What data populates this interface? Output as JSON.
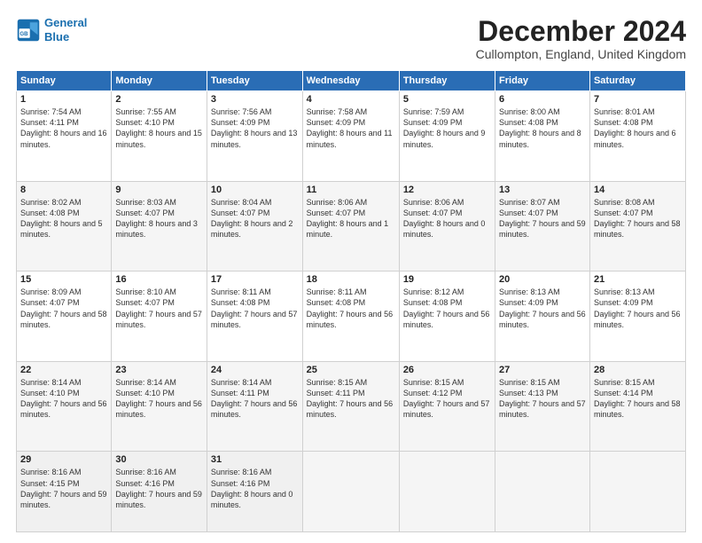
{
  "logo": {
    "line1": "General",
    "line2": "Blue"
  },
  "header": {
    "month": "December 2024",
    "location": "Cullompton, England, United Kingdom"
  },
  "weekdays": [
    "Sunday",
    "Monday",
    "Tuesday",
    "Wednesday",
    "Thursday",
    "Friday",
    "Saturday"
  ],
  "weeks": [
    [
      {
        "day": "1",
        "sunrise": "7:54 AM",
        "sunset": "4:11 PM",
        "daylight": "8 hours and 16 minutes."
      },
      {
        "day": "2",
        "sunrise": "7:55 AM",
        "sunset": "4:10 PM",
        "daylight": "8 hours and 15 minutes."
      },
      {
        "day": "3",
        "sunrise": "7:56 AM",
        "sunset": "4:09 PM",
        "daylight": "8 hours and 13 minutes."
      },
      {
        "day": "4",
        "sunrise": "7:58 AM",
        "sunset": "4:09 PM",
        "daylight": "8 hours and 11 minutes."
      },
      {
        "day": "5",
        "sunrise": "7:59 AM",
        "sunset": "4:09 PM",
        "daylight": "8 hours and 9 minutes."
      },
      {
        "day": "6",
        "sunrise": "8:00 AM",
        "sunset": "4:08 PM",
        "daylight": "8 hours and 8 minutes."
      },
      {
        "day": "7",
        "sunrise": "8:01 AM",
        "sunset": "4:08 PM",
        "daylight": "8 hours and 6 minutes."
      }
    ],
    [
      {
        "day": "8",
        "sunrise": "8:02 AM",
        "sunset": "4:08 PM",
        "daylight": "8 hours and 5 minutes."
      },
      {
        "day": "9",
        "sunrise": "8:03 AM",
        "sunset": "4:07 PM",
        "daylight": "8 hours and 3 minutes."
      },
      {
        "day": "10",
        "sunrise": "8:04 AM",
        "sunset": "4:07 PM",
        "daylight": "8 hours and 2 minutes."
      },
      {
        "day": "11",
        "sunrise": "8:06 AM",
        "sunset": "4:07 PM",
        "daylight": "8 hours and 1 minute."
      },
      {
        "day": "12",
        "sunrise": "8:06 AM",
        "sunset": "4:07 PM",
        "daylight": "8 hours and 0 minutes."
      },
      {
        "day": "13",
        "sunrise": "8:07 AM",
        "sunset": "4:07 PM",
        "daylight": "7 hours and 59 minutes."
      },
      {
        "day": "14",
        "sunrise": "8:08 AM",
        "sunset": "4:07 PM",
        "daylight": "7 hours and 58 minutes."
      }
    ],
    [
      {
        "day": "15",
        "sunrise": "8:09 AM",
        "sunset": "4:07 PM",
        "daylight": "7 hours and 58 minutes."
      },
      {
        "day": "16",
        "sunrise": "8:10 AM",
        "sunset": "4:07 PM",
        "daylight": "7 hours and 57 minutes."
      },
      {
        "day": "17",
        "sunrise": "8:11 AM",
        "sunset": "4:08 PM",
        "daylight": "7 hours and 57 minutes."
      },
      {
        "day": "18",
        "sunrise": "8:11 AM",
        "sunset": "4:08 PM",
        "daylight": "7 hours and 56 minutes."
      },
      {
        "day": "19",
        "sunrise": "8:12 AM",
        "sunset": "4:08 PM",
        "daylight": "7 hours and 56 minutes."
      },
      {
        "day": "20",
        "sunrise": "8:13 AM",
        "sunset": "4:09 PM",
        "daylight": "7 hours and 56 minutes."
      },
      {
        "day": "21",
        "sunrise": "8:13 AM",
        "sunset": "4:09 PM",
        "daylight": "7 hours and 56 minutes."
      }
    ],
    [
      {
        "day": "22",
        "sunrise": "8:14 AM",
        "sunset": "4:10 PM",
        "daylight": "7 hours and 56 minutes."
      },
      {
        "day": "23",
        "sunrise": "8:14 AM",
        "sunset": "4:10 PM",
        "daylight": "7 hours and 56 minutes."
      },
      {
        "day": "24",
        "sunrise": "8:14 AM",
        "sunset": "4:11 PM",
        "daylight": "7 hours and 56 minutes."
      },
      {
        "day": "25",
        "sunrise": "8:15 AM",
        "sunset": "4:11 PM",
        "daylight": "7 hours and 56 minutes."
      },
      {
        "day": "26",
        "sunrise": "8:15 AM",
        "sunset": "4:12 PM",
        "daylight": "7 hours and 57 minutes."
      },
      {
        "day": "27",
        "sunrise": "8:15 AM",
        "sunset": "4:13 PM",
        "daylight": "7 hours and 57 minutes."
      },
      {
        "day": "28",
        "sunrise": "8:15 AM",
        "sunset": "4:14 PM",
        "daylight": "7 hours and 58 minutes."
      }
    ],
    [
      {
        "day": "29",
        "sunrise": "8:16 AM",
        "sunset": "4:15 PM",
        "daylight": "7 hours and 59 minutes."
      },
      {
        "day": "30",
        "sunrise": "8:16 AM",
        "sunset": "4:16 PM",
        "daylight": "7 hours and 59 minutes."
      },
      {
        "day": "31",
        "sunrise": "8:16 AM",
        "sunset": "4:16 PM",
        "daylight": "8 hours and 0 minutes."
      },
      null,
      null,
      null,
      null
    ]
  ]
}
